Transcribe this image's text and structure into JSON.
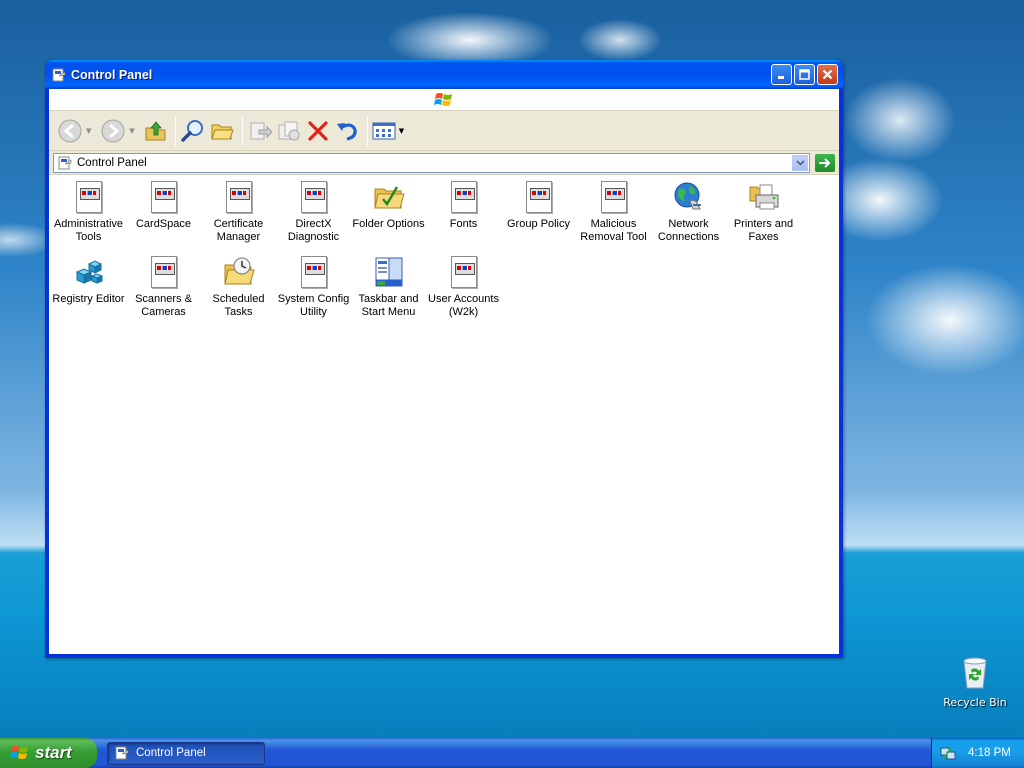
{
  "desktop": {
    "recycle_bin_label": "Recycle Bin"
  },
  "window": {
    "title": "Control Panel",
    "icon": "control-panel-icon",
    "buttons": [
      "minimize",
      "maximize",
      "close"
    ]
  },
  "toolbar": {
    "buttons": [
      {
        "name": "back",
        "icon": "back-arrow-icon",
        "enabled": false
      },
      {
        "name": "forward",
        "icon": "forward-arrow-icon",
        "enabled": false
      },
      {
        "name": "up",
        "icon": "folder-up-icon",
        "enabled": true
      },
      {
        "name": "search",
        "icon": "search-icon",
        "enabled": true
      },
      {
        "name": "folders",
        "icon": "folders-icon",
        "enabled": true
      },
      {
        "name": "move-to",
        "icon": "move-to-icon",
        "enabled": false
      },
      {
        "name": "copy-to",
        "icon": "copy-to-icon",
        "enabled": false
      },
      {
        "name": "delete",
        "icon": "delete-icon",
        "enabled": true
      },
      {
        "name": "undo",
        "icon": "undo-icon",
        "enabled": true
      },
      {
        "name": "views",
        "icon": "views-icon",
        "enabled": true
      }
    ]
  },
  "address_bar": {
    "value": "Control Panel"
  },
  "items": [
    {
      "label": "Administrative Tools",
      "icon": "applet-icon"
    },
    {
      "label": "CardSpace",
      "icon": "applet-icon"
    },
    {
      "label": "Certificate Manager",
      "icon": "applet-icon"
    },
    {
      "label": "DirectX Diagnostic",
      "icon": "applet-icon"
    },
    {
      "label": "Folder Options",
      "icon": "folder-options-icon"
    },
    {
      "label": "Fonts",
      "icon": "applet-icon"
    },
    {
      "label": "Group Policy",
      "icon": "applet-icon"
    },
    {
      "label": "Malicious Removal Tool",
      "icon": "applet-icon"
    },
    {
      "label": "Network Connections",
      "icon": "network-globe-icon"
    },
    {
      "label": "Printers and Faxes",
      "icon": "printer-icon"
    },
    {
      "label": "Registry Editor",
      "icon": "registry-cubes-icon"
    },
    {
      "label": "Scanners & Cameras",
      "icon": "applet-icon"
    },
    {
      "label": "Scheduled Tasks",
      "icon": "scheduled-tasks-folder-icon"
    },
    {
      "label": "System Config Utility",
      "icon": "applet-icon"
    },
    {
      "label": "Taskbar and Start Menu",
      "icon": "taskbar-start-menu-icon"
    },
    {
      "label": "User Accounts (W2k)",
      "icon": "applet-icon"
    }
  ],
  "taskbar": {
    "start_label": "start",
    "tasks": [
      {
        "label": "Control Panel"
      }
    ],
    "clock": "4:18 PM"
  },
  "colors": {
    "title_bar": "#0054e3",
    "toolbar_bg": "#ece9d8",
    "start_button": "#3c9a3c",
    "taskbar": "#2157d7",
    "tray": "#18a0ea"
  }
}
